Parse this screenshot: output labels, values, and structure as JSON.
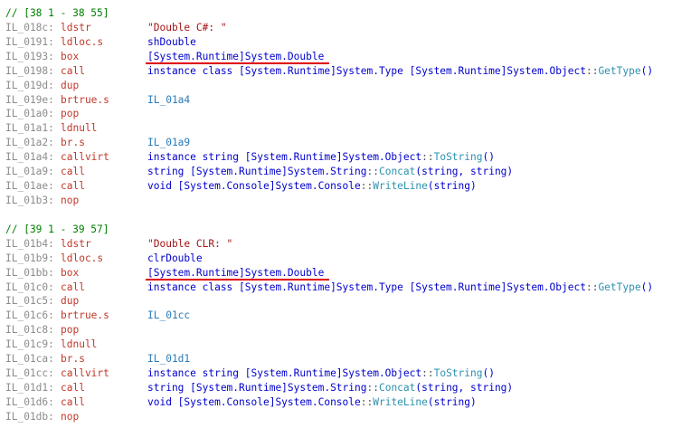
{
  "blocks": [
    {
      "comment": "// [38 1 - 38 55]",
      "lines": [
        {
          "addr": "IL_018c:",
          "op": "ldstr",
          "args": [
            {
              "k": "str",
              "t": "\"Double C#: \""
            }
          ]
        },
        {
          "addr": "IL_0191:",
          "op": "ldloc.s",
          "args": [
            {
              "k": "kw",
              "t": "shDouble"
            }
          ]
        },
        {
          "addr": "IL_0193:",
          "op": "box",
          "args": [
            {
              "k": "kw",
              "t": "[System.Runtime]System.Double"
            }
          ],
          "underline": true
        },
        {
          "addr": "IL_0198:",
          "op": "call",
          "args": [
            {
              "k": "kw",
              "t": "instance class [System.Runtime]System.Type [System.Runtime]System.Object"
            },
            {
              "k": "punct",
              "t": "::"
            },
            {
              "k": "fn",
              "t": "GetType"
            },
            {
              "k": "kw",
              "t": "()"
            }
          ]
        },
        {
          "addr": "IL_019d:",
          "op": "dup",
          "args": []
        },
        {
          "addr": "IL_019e:",
          "op": "brtrue.s",
          "args": [
            {
              "k": "label",
              "t": "IL_01a4"
            }
          ]
        },
        {
          "addr": "IL_01a0:",
          "op": "pop",
          "args": []
        },
        {
          "addr": "IL_01a1:",
          "op": "ldnull",
          "args": []
        },
        {
          "addr": "IL_01a2:",
          "op": "br.s",
          "args": [
            {
              "k": "label",
              "t": "IL_01a9"
            }
          ]
        },
        {
          "addr": "IL_01a4:",
          "op": "callvirt",
          "args": [
            {
              "k": "kw",
              "t": "instance string [System.Runtime]System.Object"
            },
            {
              "k": "punct",
              "t": "::"
            },
            {
              "k": "fn",
              "t": "ToString"
            },
            {
              "k": "kw",
              "t": "()"
            }
          ]
        },
        {
          "addr": "IL_01a9:",
          "op": "call",
          "args": [
            {
              "k": "kw",
              "t": "string [System.Runtime]System.String"
            },
            {
              "k": "punct",
              "t": "::"
            },
            {
              "k": "fn",
              "t": "Concat"
            },
            {
              "k": "kw",
              "t": "(string, string)"
            }
          ]
        },
        {
          "addr": "IL_01ae:",
          "op": "call",
          "args": [
            {
              "k": "kw",
              "t": "void [System.Console]System.Console"
            },
            {
              "k": "punct",
              "t": "::"
            },
            {
              "k": "fn",
              "t": "WriteLine"
            },
            {
              "k": "kw",
              "t": "(string)"
            }
          ]
        },
        {
          "addr": "IL_01b3:",
          "op": "nop",
          "args": []
        }
      ]
    },
    {
      "comment": "// [39 1 - 39 57]",
      "lines": [
        {
          "addr": "IL_01b4:",
          "op": "ldstr",
          "args": [
            {
              "k": "str",
              "t": "\"Double CLR: \""
            }
          ]
        },
        {
          "addr": "IL_01b9:",
          "op": "ldloc.s",
          "args": [
            {
              "k": "kw",
              "t": "clrDouble"
            }
          ]
        },
        {
          "addr": "IL_01bb:",
          "op": "box",
          "args": [
            {
              "k": "kw",
              "t": "[System.Runtime]System.Double"
            }
          ],
          "underline": true
        },
        {
          "addr": "IL_01c0:",
          "op": "call",
          "args": [
            {
              "k": "kw",
              "t": "instance class [System.Runtime]System.Type [System.Runtime]System.Object"
            },
            {
              "k": "punct",
              "t": "::"
            },
            {
              "k": "fn",
              "t": "GetType"
            },
            {
              "k": "kw",
              "t": "()"
            }
          ]
        },
        {
          "addr": "IL_01c5:",
          "op": "dup",
          "args": []
        },
        {
          "addr": "IL_01c6:",
          "op": "brtrue.s",
          "args": [
            {
              "k": "label",
              "t": "IL_01cc"
            }
          ]
        },
        {
          "addr": "IL_01c8:",
          "op": "pop",
          "args": []
        },
        {
          "addr": "IL_01c9:",
          "op": "ldnull",
          "args": []
        },
        {
          "addr": "IL_01ca:",
          "op": "br.s",
          "args": [
            {
              "k": "label",
              "t": "IL_01d1"
            }
          ]
        },
        {
          "addr": "IL_01cc:",
          "op": "callvirt",
          "args": [
            {
              "k": "kw",
              "t": "instance string [System.Runtime]System.Object"
            },
            {
              "k": "punct",
              "t": "::"
            },
            {
              "k": "fn",
              "t": "ToString"
            },
            {
              "k": "kw",
              "t": "()"
            }
          ]
        },
        {
          "addr": "IL_01d1:",
          "op": "call",
          "args": [
            {
              "k": "kw",
              "t": "string [System.Runtime]System.String"
            },
            {
              "k": "punct",
              "t": "::"
            },
            {
              "k": "fn",
              "t": "Concat"
            },
            {
              "k": "kw",
              "t": "(string, string)"
            }
          ]
        },
        {
          "addr": "IL_01d6:",
          "op": "call",
          "args": [
            {
              "k": "kw",
              "t": "void [System.Console]System.Console"
            },
            {
              "k": "punct",
              "t": "::"
            },
            {
              "k": "fn",
              "t": "WriteLine"
            },
            {
              "k": "kw",
              "t": "(string)"
            }
          ]
        },
        {
          "addr": "IL_01db:",
          "op": "nop",
          "args": []
        }
      ]
    }
  ],
  "colors": {
    "comment": "#008000",
    "address": "#8c8c8c",
    "opcode": "#c0392b",
    "string": "#a31515",
    "keyword": "#0000cd",
    "method": "#2b91af",
    "label": "#2b7bb9",
    "underline": "#e00000"
  }
}
